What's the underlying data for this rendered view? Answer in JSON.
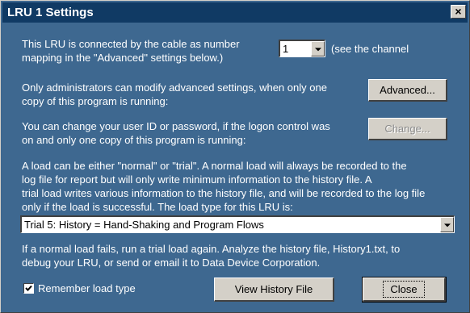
{
  "window": {
    "title": "LRU 1 Settings",
    "close_glyph": "×"
  },
  "cable": {
    "line1": "This LRU is connected by the cable as number",
    "line2": "mapping in the \"Advanced\" settings below.)",
    "number_value": "1",
    "note": "(see the channel"
  },
  "admin": {
    "line1": "Only administrators can modify advanced settings, when only one",
    "line2": "copy of this program is running:",
    "advanced_button": "Advanced..."
  },
  "user": {
    "line1": "You can change your user ID or password, if the logon control was",
    "line2": "on and only one copy of this program is running:",
    "change_button": "Change..."
  },
  "load": {
    "lines": [
      "A load can be either \"normal\" or \"trial\".  A normal load will always be recorded to the",
      "log file for report but will only write minimum information to the history file.  A",
      "trial load writes various information to the history file, and will be recorded to the log file",
      "only if the load is successful.  The load type for this LRU is:"
    ],
    "type_value": "Trial 5: History = Hand-Shaking and Program Flows"
  },
  "failure": {
    "line1": "If a normal load fails, run a trial load again.  Analyze the history file, History1.txt, to",
    "line2": "debug your LRU, or send or email it to Data Device Corporation."
  },
  "footer": {
    "remember_label": "Remember load type",
    "remember_checked": true,
    "view_history_button": "View History File",
    "close_button": "Close"
  },
  "colors": {
    "dialog_background": "#3e6890",
    "titlebar": "#103a64",
    "button_face": "#d4d0c8"
  },
  "icons": {
    "close": "close-icon",
    "dropdown": "chevron-down-icon",
    "check": "check-icon"
  }
}
